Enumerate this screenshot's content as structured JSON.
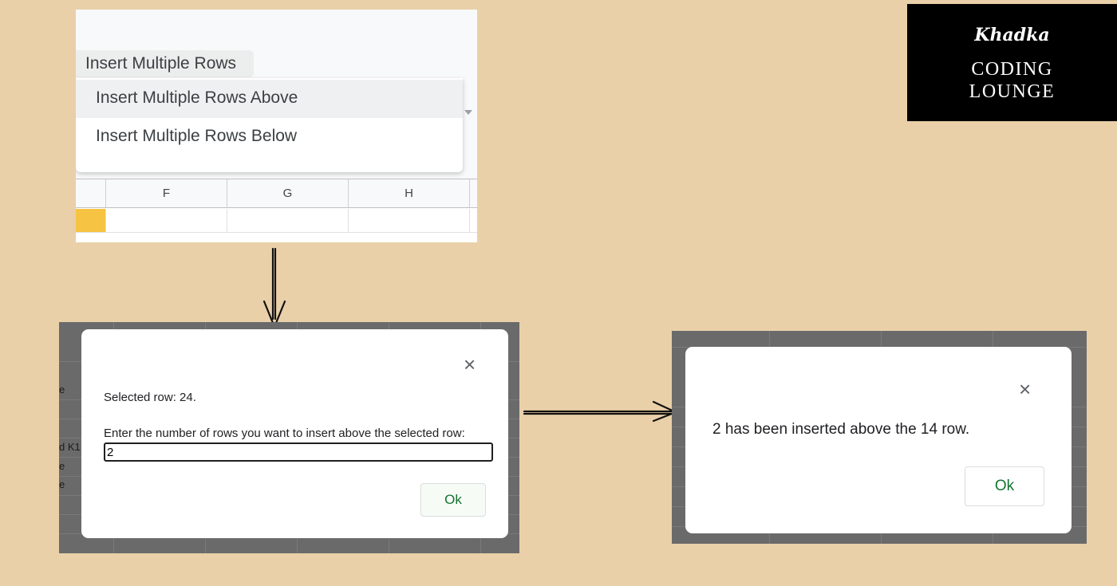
{
  "menu_panel": {
    "trigger_label": "Insert Multiple Rows",
    "items": [
      {
        "label": "Insert Multiple Rows Above"
      },
      {
        "label": "Insert Multiple Rows Below"
      }
    ],
    "columns": [
      "F",
      "G",
      "H"
    ],
    "highlight_color": "#f6c342"
  },
  "prompt_dialog": {
    "close_glyph": "×",
    "selected_row_text": "Selected row: 24.",
    "question": "Enter the number of rows you want to insert above the selected row:",
    "input_value": "2",
    "ok_label": "Ok",
    "background_fragments": [
      "e",
      "d K1",
      "e",
      "e"
    ]
  },
  "alert_dialog": {
    "close_glyph": "×",
    "message": "2 has been inserted above the 14 row.",
    "ok_label": "Ok"
  },
  "logo": {
    "script_text": "Khadka",
    "line1": "CODING",
    "line2": "LOUNGE"
  },
  "colors": {
    "page_background": "#e9d0a9",
    "ok_text": "#137333",
    "logo_background": "#000000"
  }
}
